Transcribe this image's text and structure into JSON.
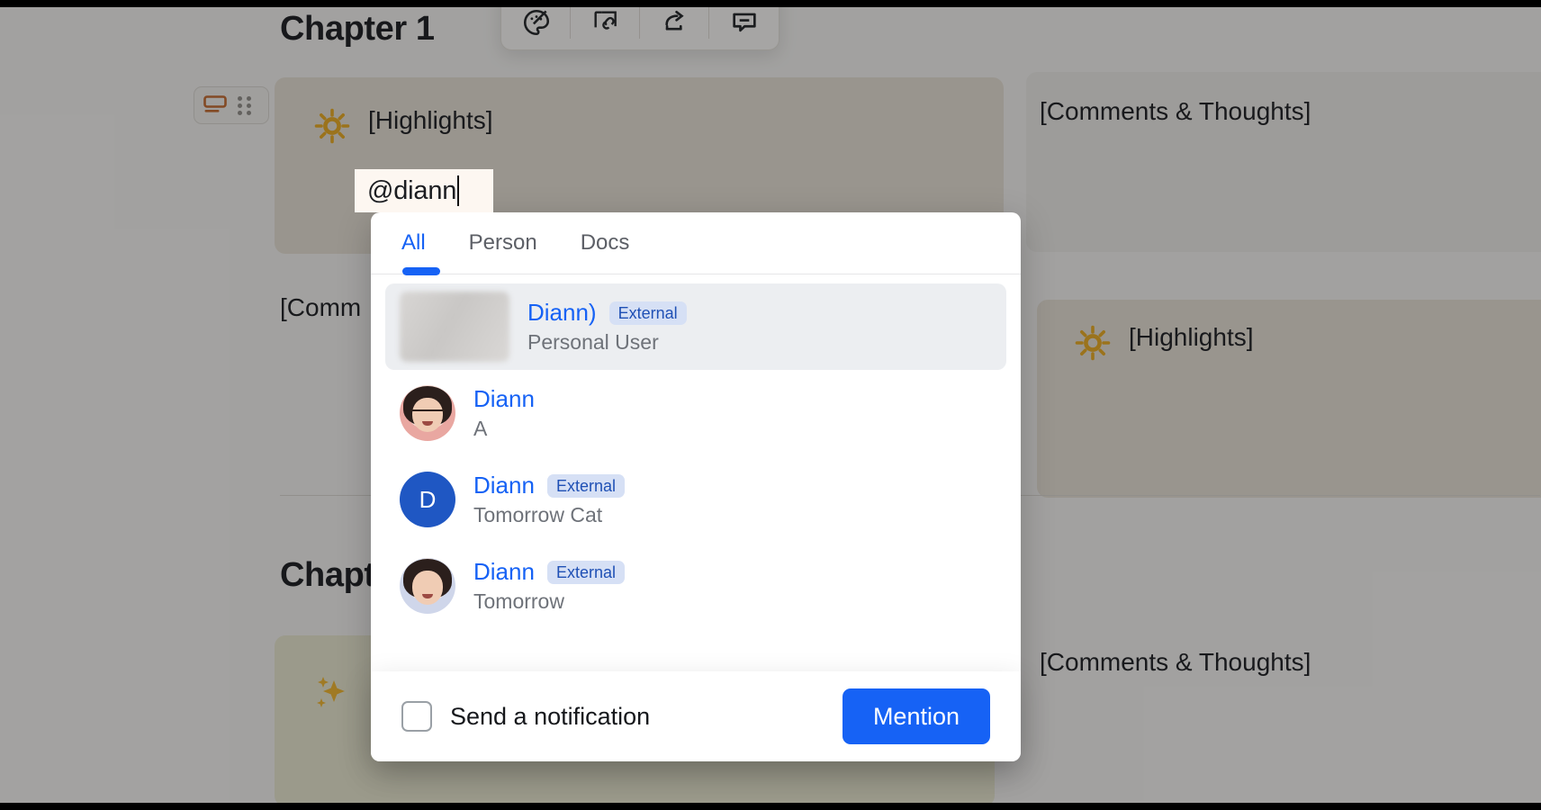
{
  "document": {
    "chapter_1_title": "Chapter 1",
    "chapter_2_title": "Chapt",
    "blocks": {
      "highlights_left_label": "[Highlights]",
      "highlights_left_emoji": "sun-emoji",
      "highlights_right_label": "[Highlights]",
      "highlights_right_emoji": "sun-emoji",
      "comments_top_label": "[Comments & Thoughts]",
      "comments_mid_label": "[Comm",
      "comments_bottom_label": "[Comments & Thoughts]",
      "sparkle_block_emoji": "sparkles-emoji"
    }
  },
  "toolbar": {
    "buttons": [
      {
        "name": "palette-icon",
        "title": "Style"
      },
      {
        "name": "copy-link-icon",
        "title": "Copy link"
      },
      {
        "name": "share-icon",
        "title": "Share"
      },
      {
        "name": "comment-icon",
        "title": "Comment"
      }
    ]
  },
  "block_handle": {
    "callout_icon": "callout-icon",
    "drag_icon": "drag-handle-icon"
  },
  "mention_input": {
    "value": "@diann"
  },
  "mention_popover": {
    "tabs": [
      {
        "label": "All",
        "active": true
      },
      {
        "label": "Person",
        "active": false
      },
      {
        "label": "Docs",
        "active": false
      }
    ],
    "results": [
      {
        "name": "Diann)",
        "badge": "External",
        "subtitle": "Personal User",
        "avatar": "blurred-avatar",
        "selected": true
      },
      {
        "name": "Diann",
        "badge": "",
        "subtitle": "A",
        "avatar": "photo-avatar-glasses",
        "selected": false
      },
      {
        "name": "Diann",
        "badge": "External",
        "subtitle": "Tomorrow Cat",
        "avatar": "initial-avatar",
        "avatar_initial": "D",
        "selected": false
      },
      {
        "name": "Diann",
        "badge": "External",
        "subtitle": "Tomorrow",
        "avatar": "photo-avatar",
        "selected": false
      }
    ],
    "footer": {
      "checkbox_label": "Send a notification",
      "checkbox_checked": false,
      "submit_label": "Mention"
    }
  },
  "colors": {
    "accent_blue": "#1662f5",
    "badge_bg": "#d6e0f5",
    "badge_text": "#1f50b5",
    "highlight_block": "#e6dfd3",
    "sparkle_block": "#e9e7cf",
    "comment_block": "#eceae7",
    "callout_orange": "#c2672a"
  }
}
